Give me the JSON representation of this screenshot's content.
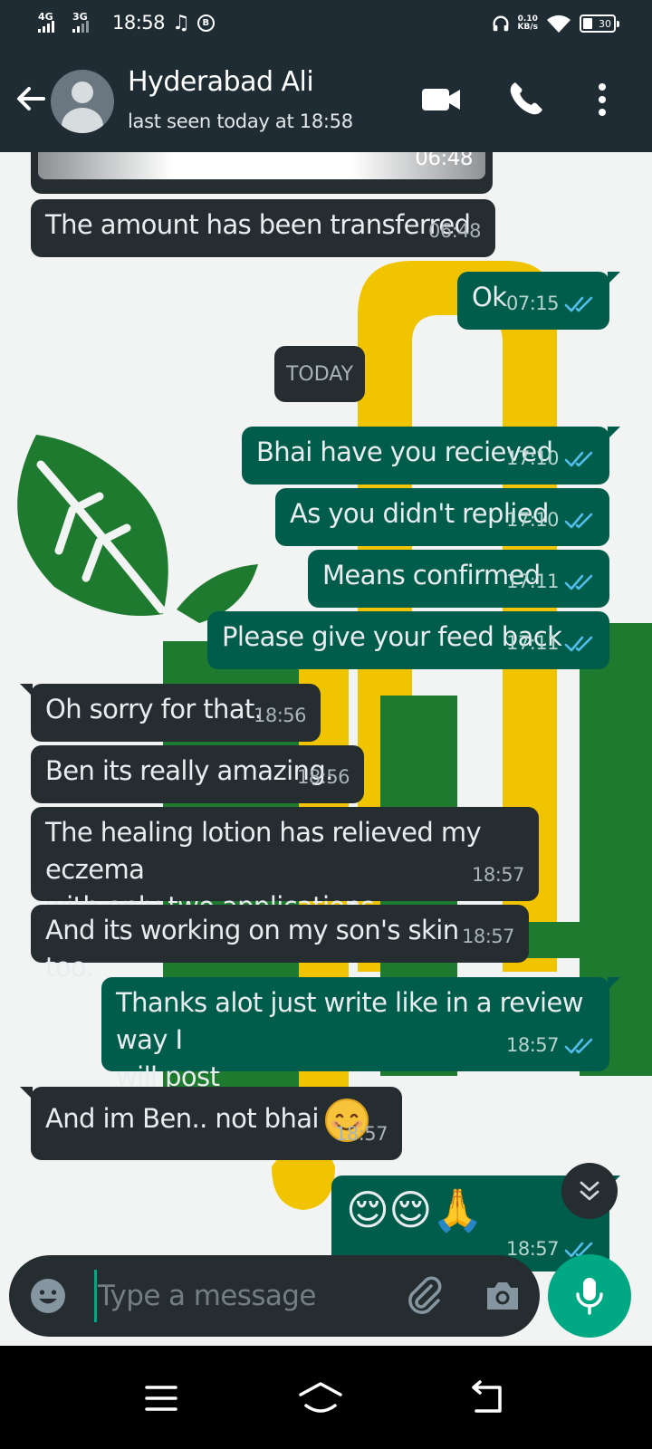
{
  "status_bar": {
    "network1": "4G",
    "network2": "3G",
    "time": "18:58",
    "b_badge": "B",
    "speed_value": "0.10",
    "speed_unit": "KB/s",
    "battery": "30"
  },
  "header": {
    "contact_name": "Hyderabad Ali",
    "contact_status": "last seen today at 18:58"
  },
  "chat": {
    "image_time": "06:48",
    "date_separator": "TODAY",
    "messages": [
      {
        "text": "The amount has been transferred",
        "time": "06:48"
      },
      {
        "text": "Ok",
        "time": "07:15"
      },
      {
        "text": "Bhai have you recieved",
        "time": "17:10"
      },
      {
        "text": "As you didn't replied",
        "time": "17:10"
      },
      {
        "text": "Means confirmed",
        "time": "17:11"
      },
      {
        "text": "Please give your feed back",
        "time": "17:11"
      },
      {
        "text": "Oh sorry for that.",
        "time": "18:56"
      },
      {
        "text": "Ben its really amazing.",
        "time": "18:56"
      },
      {
        "text": "The healing lotion has relieved my eczema\nwith only two applications",
        "time": "18:57"
      },
      {
        "text": "And its working on my son's skin too.",
        "time": "18:57"
      },
      {
        "text": "Thanks alot just write like in a review way I\nwill post",
        "time": "18:57"
      },
      {
        "text": "And im Ben.. not bhai",
        "time": "18:57"
      },
      {
        "text": "😌😌🙏",
        "time": "18:57"
      }
    ]
  },
  "composer": {
    "placeholder": "Type a message"
  },
  "colors": {
    "header_bg": "#1f2c34",
    "incoming_bubble": "#252d31",
    "outgoing_bubble": "#005c4b",
    "read_ticks": "#53bdeb",
    "accent": "#00a884"
  }
}
